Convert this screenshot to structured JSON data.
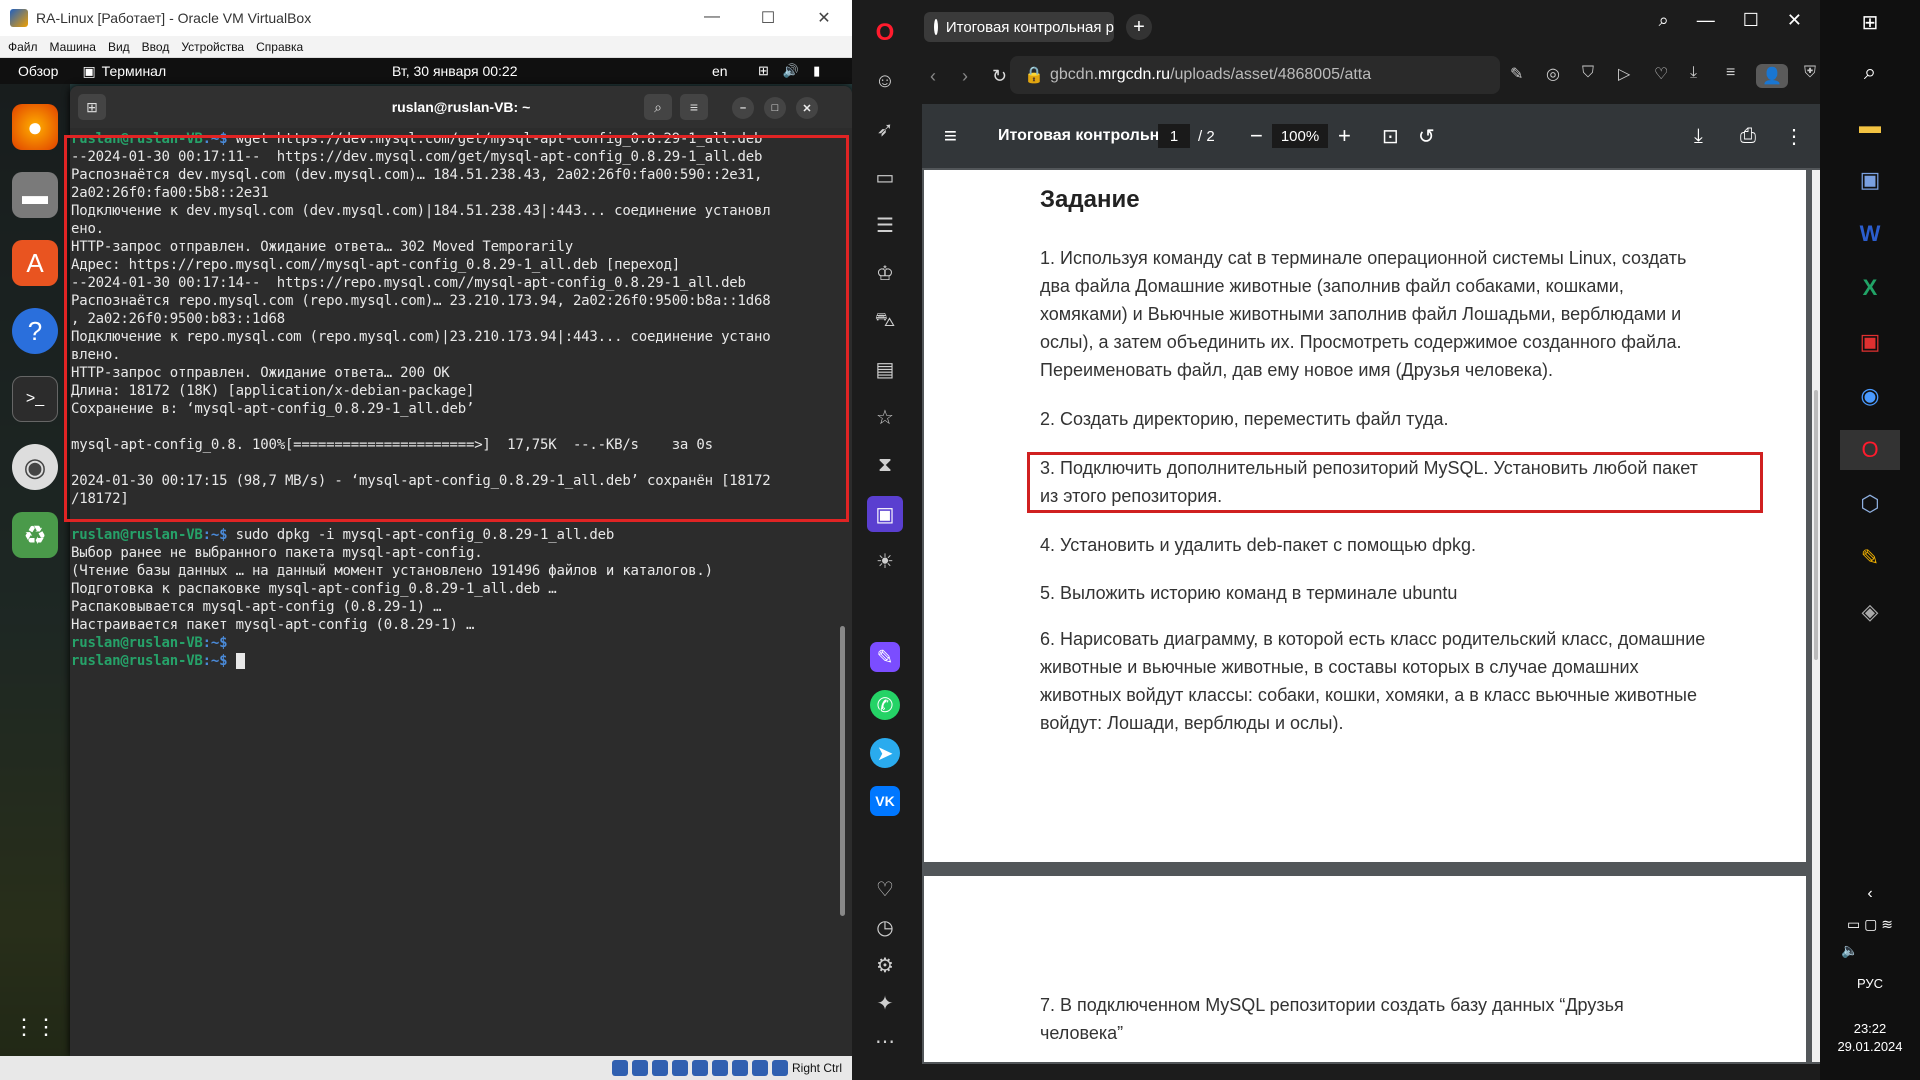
{
  "vbox": {
    "title": "RA-Linux [Работает] - Oracle VM VirtualBox",
    "menu": [
      "Файл",
      "Машина",
      "Вид",
      "Ввод",
      "Устройства",
      "Справка"
    ],
    "status_right_ctrl": "Right Ctrl"
  },
  "guest": {
    "overview": "Обзор",
    "app_name": "Терминал",
    "clock": "Вт, 30 января  00:22",
    "lang": "en"
  },
  "terminal": {
    "title": "ruslan@ruslan-VB: ~",
    "prompt_user": "ruslan@ruslan-VB",
    "prompt_path": ":~$ ",
    "cmd1": "wget https://dev.mysql.com/get/mysql-apt-config_0.8.29-1_all.deb",
    "out1": [
      "--2024-01-30 00:17:11--  https://dev.mysql.com/get/mysql-apt-config_0.8.29-1_all.deb",
      "Распознаётся dev.mysql.com (dev.mysql.com)… 184.51.238.43, 2a02:26f0:fa00:590::2e31,",
      "2a02:26f0:fa00:5b8::2e31",
      "Подключение к dev.mysql.com (dev.mysql.com)|184.51.238.43|:443... соединение установл",
      "ено.",
      "HTTP-запрос отправлен. Ожидание ответа… 302 Moved Temporarily",
      "Адрес: https://repo.mysql.com//mysql-apt-config_0.8.29-1_all.deb [переход]",
      "--2024-01-30 00:17:14--  https://repo.mysql.com//mysql-apt-config_0.8.29-1_all.deb",
      "Распознаётся repo.mysql.com (repo.mysql.com)… 23.210.173.94, 2a02:26f0:9500:b8a::1d68",
      ", 2a02:26f0:9500:b83::1d68",
      "Подключение к repo.mysql.com (repo.mysql.com)|23.210.173.94|:443... соединение устано",
      "влено.",
      "HTTP-запрос отправлен. Ожидание ответа… 200 OK",
      "Длина: 18172 (18K) [application/x-debian-package]",
      "Сохранение в: ‘mysql-apt-config_0.8.29-1_all.deb’",
      "",
      "mysql-apt-config_0.8. 100%[======================>]  17,75K  --.-KB/s    за 0s",
      "",
      "2024-01-30 00:17:15 (98,7 MB/s) - ‘mysql-apt-config_0.8.29-1_all.deb’ сохранён [18172",
      "/18172]",
      ""
    ],
    "cmd2": "sudo dpkg -i mysql-apt-config_0.8.29-1_all.deb",
    "out2": [
      "Выбор ранее не выбранного пакета mysql-apt-config.",
      "(Чтение базы данных … на данный момент установлено 191496 файлов и каталогов.)",
      "Подготовка к распаковке mysql-apt-config_0.8.29-1_all.deb …",
      "Распаковывается mysql-apt-config (0.8.29-1) …",
      "Настраивается пакет mysql-apt-config (0.8.29-1) …"
    ]
  },
  "opera": {
    "tab_title": "Итоговая контрольная р",
    "url_pre": "gbcdn.",
    "url_domain": "mrgcdn.ru",
    "url_post": "/uploads/asset/4868005/atta",
    "pdf_name": "Итоговая контрольн...",
    "page_current": "1",
    "page_total": "/  2",
    "zoom": "100%"
  },
  "doc": {
    "heading": "Задание",
    "p1": [
      "1. Используя команду cat в терминале операционной системы Linux, создать",
      "два файла Домашние животные (заполнив файл собаками, кошками,",
      "хомяками) и Вьючные животными заполнив файл Лошадьми, верблюдами и",
      "ослы), а затем объединить их. Просмотреть содержимое созданного файла.",
      "Переименовать файл, дав ему новое имя (Друзья человека)."
    ],
    "p2": "2. Создать директорию, переместить файл туда.",
    "p3": [
      "3. Подключить дополнительный репозиторий MySQL. Установить любой пакет",
      "из этого репозитория."
    ],
    "p4": "4. Установить и удалить deb-пакет с помощью dpkg.",
    "p5": "5. Выложить историю команд в терминале ubuntu",
    "p6": [
      "6. Нарисовать диаграмму, в которой есть класс родительский класс, домашние",
      "животные и вьючные животные, в составы которых в случае домашних",
      "животных войдут классы: собаки, кошки, хомяки, а в класс вьючные животные",
      "войдут: Лошади, верблюды и ослы)."
    ],
    "p7": [
      "7. В подключенном MySQL репозитории создать базу данных “Друзья",
      "человека”"
    ]
  },
  "windows": {
    "lang": "РУС",
    "time": "23:22",
    "date": "29.01.2024"
  },
  "colors": {
    "prompt_user": "#26a269",
    "prompt_path": "#4a8ad8",
    "highlight": "#e02424",
    "opera_red": "#ff1b2d"
  }
}
